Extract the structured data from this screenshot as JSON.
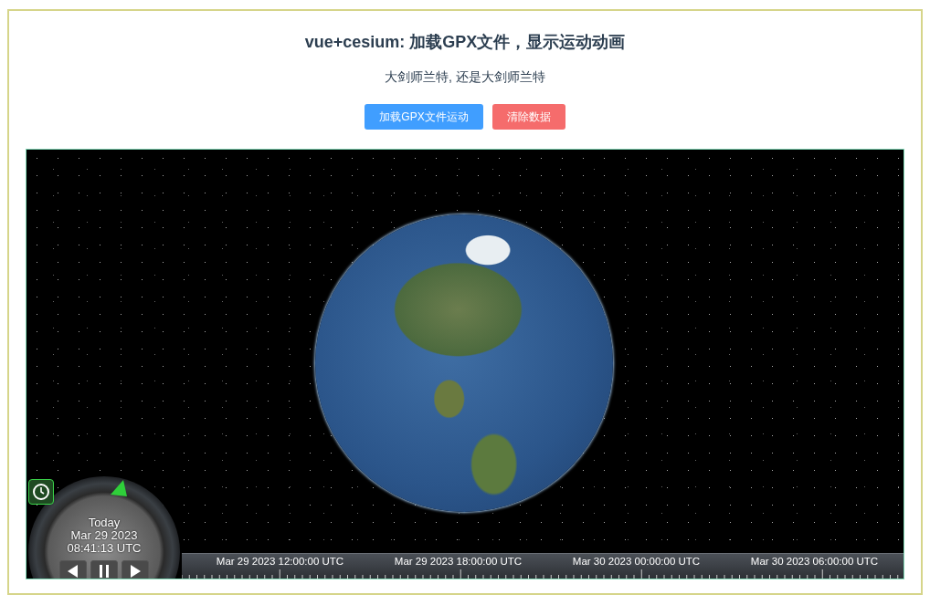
{
  "title": "vue+cesium: 加载GPX文件，显示运动动画",
  "subtitle": "大剑师兰特, 还是大剑师兰特",
  "buttons": [
    {
      "label": "加载GPX文件运动",
      "kind": "primary"
    },
    {
      "label": "清除数据",
      "kind": "danger"
    }
  ],
  "viewer": {
    "animation": {
      "day": "Today",
      "date": "Mar 29 2023",
      "time": "08:41:13 UTC"
    },
    "timeline": {
      "labels": [
        "Mar 29 2023 12:00:00 UTC",
        "Mar 29 2023 18:00:00 UTC",
        "Mar 30 2023 00:00:00 UTC",
        "Mar 30 2023 06:00:00 UTC"
      ]
    }
  }
}
